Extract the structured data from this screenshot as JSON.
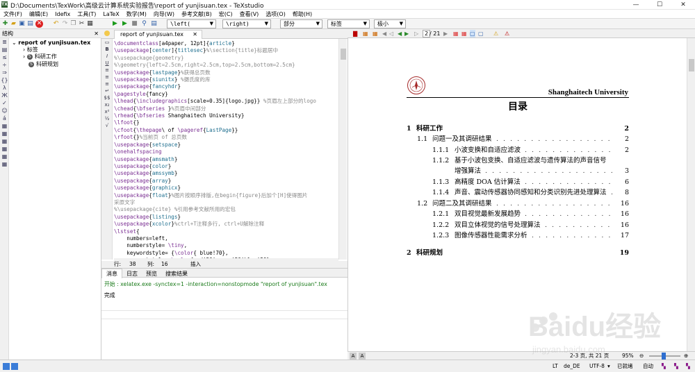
{
  "window": {
    "title": "D:\\Documents\\TexWork\\高级云计算系统实验报告\\report of yunjisuan.tex - TeXstudio",
    "minimize": "—",
    "maximize": "☐",
    "close": "✕"
  },
  "menubar": [
    "文件(F)",
    "编辑(E)",
    "Idefix",
    "工具(T)",
    "LaTeX",
    "数学(M)",
    "向导(W)",
    "参考文献(B)",
    "宏(C)",
    "查看(V)",
    "选项(O)",
    "帮助(H)"
  ],
  "toolbar": {
    "left_sel": "\\left(",
    "right_sel": "\\right)",
    "part_sel": "部分",
    "label_sel": "标签",
    "size_sel": "极小"
  },
  "structure": {
    "header": "结构",
    "close": "✕",
    "root": "report of yunjisuan.tex",
    "items": [
      "标签",
      "科研工作",
      "科研规划"
    ]
  },
  "editor": {
    "tab_label": "report of yunjisuan.tex",
    "tab_close": "✕",
    "lines": [
      [
        [
          "k",
          "\\documentclass"
        ],
        [
          "t",
          "[a4paper, 12pt]{"
        ],
        [
          "b",
          "article"
        ],
        [
          "t",
          "}"
        ]
      ],
      [
        [
          "k",
          "\\usepackage"
        ],
        [
          "t",
          "["
        ],
        [
          "b",
          "center"
        ],
        [
          "t",
          "]{"
        ],
        [
          "b",
          "titlesec"
        ],
        [
          "t",
          "}"
        ],
        [
          "cm",
          "%\\section{title}标题居中"
        ]
      ],
      [
        [
          "cm",
          "%\\usepackage{geometry}"
        ]
      ],
      [
        [
          "cm",
          "%\\geometry{left=2.5cm,right=2.5cm,top=2.5cm,bottom=2.5cm}"
        ]
      ],
      [
        [
          "k",
          "\\usepackage"
        ],
        [
          "t",
          "{"
        ],
        [
          "b",
          "lastpage"
        ],
        [
          "t",
          "}"
        ],
        [
          "cm",
          "%获得总页数"
        ]
      ],
      [
        [
          "k",
          "\\usepackage"
        ],
        [
          "t",
          "{"
        ],
        [
          "b",
          "siunitx"
        ],
        [
          "t",
          "} "
        ],
        [
          "cm",
          "%摄氏度的库"
        ]
      ],
      [
        [
          "k",
          "\\usepackage"
        ],
        [
          "t",
          "{"
        ],
        [
          "b",
          "fancyhdr"
        ],
        [
          "t",
          "}"
        ]
      ],
      [
        [
          "k",
          "\\pagestyle"
        ],
        [
          "t",
          "{fancy}"
        ]
      ],
      [
        [
          "k",
          "\\lhead"
        ],
        [
          "t",
          "{"
        ],
        [
          "k",
          "\\includegraphics"
        ],
        [
          "t",
          "[scale=0.35]{logo.jpg}} "
        ],
        [
          "cm",
          "%页眉左上部分的logo"
        ]
      ],
      [
        [
          "k",
          "\\chead"
        ],
        [
          "t",
          "{"
        ],
        [
          "k",
          "\\bfseries"
        ],
        [
          "t",
          " }"
        ],
        [
          "cm",
          "%页眉中间部分"
        ]
      ],
      [
        [
          "k",
          "\\rhead"
        ],
        [
          "t",
          "{"
        ],
        [
          "k",
          "\\bfseries"
        ],
        [
          "t",
          " Shanghaitech University}"
        ]
      ],
      [
        [
          "k",
          "\\lfoot"
        ],
        [
          "t",
          "{}"
        ]
      ],
      [
        [
          "k",
          "\\cfoot"
        ],
        [
          "t",
          "{"
        ],
        [
          "k",
          "\\thepage"
        ],
        [
          "t",
          "\\ of "
        ],
        [
          "k",
          "\\pageref"
        ],
        [
          "t",
          "{"
        ],
        [
          "b",
          "LastPage"
        ],
        [
          "t",
          "}}"
        ]
      ],
      [
        [
          "k",
          "\\rfoot"
        ],
        [
          "t",
          "{}"
        ],
        [
          "cm",
          "%当前页 of 总页数"
        ]
      ],
      [
        [
          "k",
          "\\usepackage"
        ],
        [
          "t",
          "{"
        ],
        [
          "b",
          "setspace"
        ],
        [
          "t",
          "}"
        ]
      ],
      [
        [
          "k",
          "\\onehalfspacing"
        ]
      ],
      [
        [
          "k",
          "\\usepackage"
        ],
        [
          "t",
          "{"
        ],
        [
          "b",
          "amsmath"
        ],
        [
          "t",
          "}"
        ]
      ],
      [
        [
          "k",
          "\\usepackage"
        ],
        [
          "t",
          "{"
        ],
        [
          "b",
          "color"
        ],
        [
          "t",
          "}"
        ]
      ],
      [
        [
          "k",
          "\\usepackage"
        ],
        [
          "t",
          "{"
        ],
        [
          "b",
          "amssymb"
        ],
        [
          "t",
          "}"
        ]
      ],
      [
        [
          "k",
          "\\usepackage"
        ],
        [
          "t",
          "{"
        ],
        [
          "b",
          "array"
        ],
        [
          "t",
          "}"
        ]
      ],
      [
        [
          "k",
          "\\usepackage"
        ],
        [
          "t",
          "{"
        ],
        [
          "b",
          "graphicx"
        ],
        [
          "t",
          "}"
        ]
      ],
      [
        [
          "k",
          "\\usepackage"
        ],
        [
          "t",
          "{"
        ],
        [
          "b",
          "float"
        ],
        [
          "t",
          "}"
        ],
        [
          "cm",
          "%图片按顺序排版,在begin{figure}后加个[H]使得图片"
        ]
      ],
      [
        [
          "cm",
          "采原文字"
        ]
      ],
      [
        [
          "cm",
          "%\\usepackage{cite} %引用参考文献所用的宏包"
        ]
      ],
      [
        [
          "k",
          "\\usepackage"
        ],
        [
          "t",
          "{"
        ],
        [
          "b",
          "listings"
        ],
        [
          "t",
          "}"
        ]
      ],
      [
        [
          "k",
          "\\usepackage"
        ],
        [
          "t",
          "{"
        ],
        [
          "b",
          "xcolor"
        ],
        [
          "t",
          "}"
        ],
        [
          "cm",
          "%ctrl+T注释多行, ctrl+U解除注释"
        ]
      ],
      [
        [
          "k",
          "\\lstset"
        ],
        [
          "t",
          "{"
        ]
      ],
      [
        [
          "t",
          "    numbers=left,"
        ]
      ],
      [
        [
          "t",
          "    numberstyle= "
        ],
        [
          "k",
          "\\tiny"
        ],
        [
          "t",
          ","
        ]
      ],
      [
        [
          "t",
          "    keywordstyle= "
        ],
        [
          "t",
          "{"
        ],
        [
          "k",
          "\\color"
        ],
        [
          "t",
          "{ blue!70},"
        ]
      ],
      [
        [
          "t",
          "    commentstyle= "
        ],
        [
          "k",
          "\\color"
        ],
        [
          "t",
          "{red!50!green!50!blue!50}"
        ]
      ]
    ],
    "status": {
      "row_label": "行:",
      "row": "38",
      "col_label": "列:",
      "col": "16",
      "mode": "插入"
    }
  },
  "messages": {
    "tabs": [
      "消息",
      "日志",
      "预览",
      "搜索结果"
    ],
    "log": "开始 : xelatex.exe -synctex=1 -interaction=nonstopmode \"report of yunjisuan\".tex",
    "done": "完成"
  },
  "pdf": {
    "page_input": "2",
    "page_total": "/ 21",
    "university": "Shanghaitech University",
    "toc_title": "目录",
    "toc": [
      {
        "level": 1,
        "num": "1",
        "text": "科研工作",
        "page": "2"
      },
      {
        "level": 2,
        "num": "1.1",
        "text": "问题一及其调研结果",
        "page": "2"
      },
      {
        "level": 3,
        "num": "1.1.1",
        "text": "小波变换和自适应滤波",
        "page": "2"
      },
      {
        "level": 3,
        "num": "1.1.2",
        "text": "基于小波包变换、自适应滤波与遗传算法的声音信号",
        "page": ""
      },
      {
        "level": 4,
        "num": "",
        "text": "增强算法",
        "page": "3"
      },
      {
        "level": 3,
        "num": "1.1.3",
        "text": "高精度 DOA 估计算法",
        "page": "6"
      },
      {
        "level": 3,
        "num": "1.1.4",
        "text": "声音、震动传感器协同感知和分类识别先进处理算法",
        "page": "8"
      },
      {
        "level": 2,
        "num": "1.2",
        "text": "问题二及其调研结果",
        "page": "16"
      },
      {
        "level": 3,
        "num": "1.2.1",
        "text": "双目视觉最新发展趋势",
        "page": "16"
      },
      {
        "level": 3,
        "num": "1.2.2",
        "text": "双目立体视觉的信号处理算法",
        "page": "16"
      },
      {
        "level": 3,
        "num": "1.2.3",
        "text": "图像传感器性能需求分析",
        "page": "17"
      },
      {
        "level": 1,
        "num": "2",
        "text": "科研规划",
        "page": "19"
      }
    ],
    "status_pages": "2-3 页, 共 21 页",
    "zoom": "95%"
  },
  "statusbar": {
    "lang": "de_DE",
    "enc": "UTF-8",
    "ready": "已就绪",
    "auto": "自动"
  },
  "watermark": {
    "brand": "Baidu经验",
    "url": "jingyan.baidu.com"
  }
}
